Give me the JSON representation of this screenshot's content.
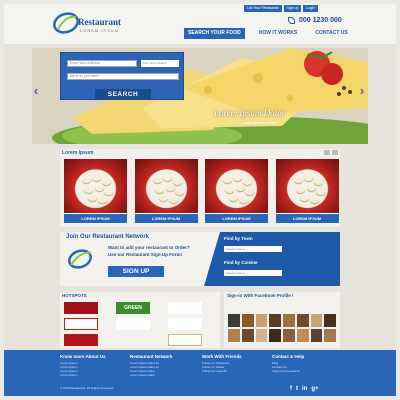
{
  "header": {
    "logo_title": "Restaurant",
    "logo_sub": "LOREM IPSUM",
    "top_links": [
      "List Your Restaurant",
      "Sign up",
      "Login"
    ],
    "phone": "000 1230 000"
  },
  "nav": {
    "items": [
      {
        "label": "SEARCH YOUR FOOD",
        "active": true
      },
      {
        "label": "HOW IT WORKS",
        "active": false
      },
      {
        "label": "CONTACT US",
        "active": false
      }
    ]
  },
  "hero": {
    "caption": "Lorem Ipsum Dolor",
    "subcaption": "Lorem ipsum dolor",
    "search": {
      "input1_placeholder": "Enter Your Address",
      "input1_small": "City name Search",
      "input2_placeholder": "What do you want?",
      "button": "SEARCH"
    }
  },
  "featured": {
    "title": "Lorem Ipsum",
    "cards": [
      {
        "label": "LOREM IPSUM"
      },
      {
        "label": "LOREM IPSUM"
      },
      {
        "label": "LOREM IPSUM"
      },
      {
        "label": "LOREM IPSUM"
      }
    ]
  },
  "network": {
    "title": "Join Our Restaurant Network",
    "line1": "Want to add your restaurant to Order?",
    "line2": "Use our Restaurant Sign-Up Form!",
    "signup": "SIGN UP",
    "find_by_town": "Find by Town",
    "find_by_cuisine": "Find by Cuisine",
    "select_placeholder": "Select cuisine"
  },
  "hotspots": {
    "title": "HOTSPOTS",
    "logos": [
      "",
      "GREEN",
      "",
      "",
      "",
      ""
    ]
  },
  "facebook": {
    "title": "Sign-in With Facebook Profile !"
  },
  "footer": {
    "columns": [
      {
        "title": "Know more About Us",
        "links": [
          "Lorem Ipsum",
          "Lorem Ipsum",
          "Lorem Ipsum",
          "Lorem Ipsum"
        ]
      },
      {
        "title": "Restaurant Network",
        "links": [
          "Lorem ipsum dolor sit",
          "Lorem ipsum dolor sit",
          "Lorem ipsum dolor",
          "Lorem ipsum dolor"
        ]
      },
      {
        "title": "Work With Friends",
        "links": [
          "Follow on Facebook",
          "Follow on Twitter",
          "Follow on LinkedIn"
        ]
      },
      {
        "title": "Contact & Help",
        "links": [
          "FAQ",
          "Contact Us",
          "Support & Feedback"
        ]
      }
    ],
    "copyright": "© 2013 Restaurant. All Rights Reserved.",
    "social": [
      "f",
      "t",
      "in",
      "g+"
    ]
  },
  "colors": {
    "brand_blue": "#2a66b8",
    "dark_blue": "#1f4f95",
    "background": "#e6e4dc"
  }
}
